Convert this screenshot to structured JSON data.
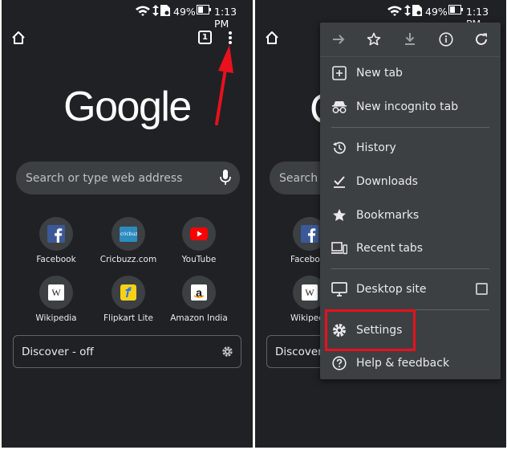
{
  "status_bar": {
    "battery_percent": "49%",
    "time": "1:13 PM"
  },
  "left": {
    "toolbar": {
      "tab_count": "1"
    },
    "logo_text": "Google",
    "search": {
      "placeholder": "Search or type web address"
    },
    "shortcuts": [
      {
        "label": "Facebook",
        "icon": "facebook-icon"
      },
      {
        "label": "Cricbuzz.com",
        "icon": "cricbuzz-icon",
        "icon_text": "cricbuzz"
      },
      {
        "label": "YouTube",
        "icon": "youtube-icon"
      },
      {
        "label": "Wikipedia",
        "icon": "wikipedia-icon",
        "icon_text": "W"
      },
      {
        "label": "Flipkart Lite",
        "icon": "flipkart-icon"
      },
      {
        "label": "Amazon India",
        "icon": "amazon-icon",
        "icon_text": "a"
      }
    ],
    "discover_label": "Discover - off"
  },
  "right": {
    "search": {
      "placeholder_partial": "Search or"
    },
    "shortcut_labels_partial": [
      "Facebo",
      "Wikiped"
    ],
    "discover_label_partial": "Discover -",
    "menu": {
      "top_icons": [
        "forward-icon",
        "bookmark-star-icon",
        "download-icon",
        "info-icon",
        "refresh-icon"
      ],
      "items": [
        {
          "label": "New tab",
          "icon": "new-tab-icon"
        },
        {
          "label": "New incognito tab",
          "icon": "incognito-icon"
        },
        {
          "label": "History",
          "icon": "history-icon"
        },
        {
          "label": "Downloads",
          "icon": "downloads-icon"
        },
        {
          "label": "Bookmarks",
          "icon": "bookmarks-star-icon"
        },
        {
          "label": "Recent tabs",
          "icon": "recent-tabs-icon"
        },
        {
          "label": "Desktop site",
          "icon": "desktop-icon",
          "checked": false
        },
        {
          "label": "Settings",
          "icon": "settings-gear-icon"
        },
        {
          "label": "Help & feedback",
          "icon": "help-icon"
        }
      ]
    }
  },
  "colors": {
    "background": "#202124",
    "surface": "#3c4043",
    "text": "#e8eaed",
    "muted_text": "#bdc1c6",
    "annotation_red": "#e8111d",
    "facebook_blue": "#3b5998",
    "youtube_red": "#ff0000",
    "flipkart_yellow": "#f8d117"
  }
}
